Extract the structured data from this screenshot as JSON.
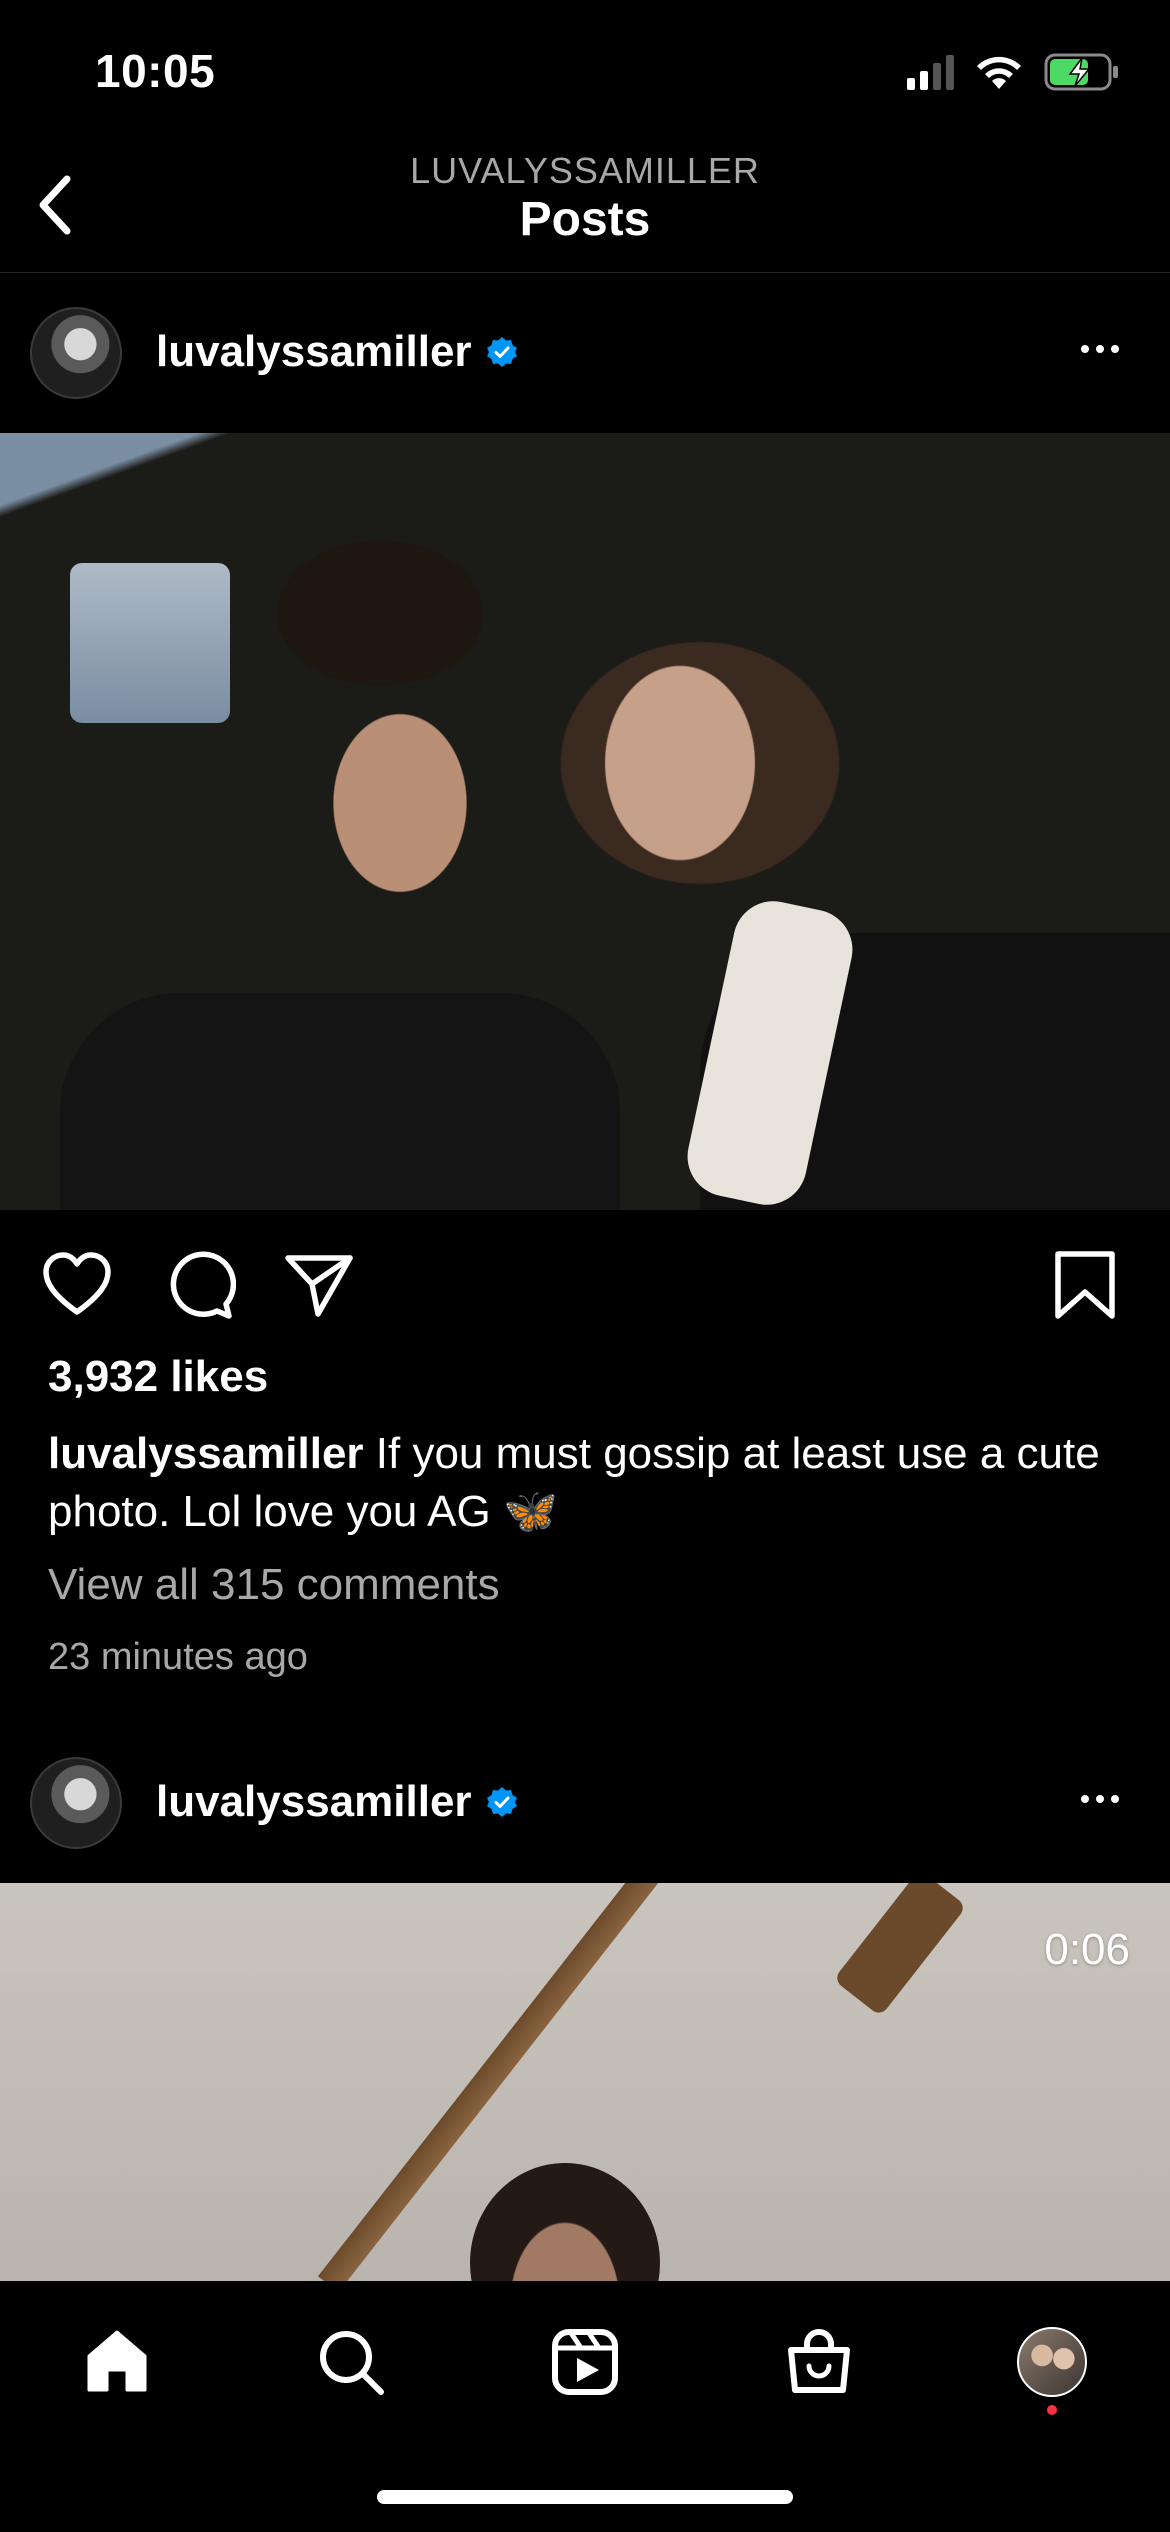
{
  "status_bar": {
    "time": "10:05",
    "icons": [
      "cellular-signal-icon",
      "wifi-icon",
      "battery-charging-icon"
    ]
  },
  "header": {
    "account": "LUVALYSSAMILLER",
    "title": "Posts",
    "back_icon": "chevron-left-icon"
  },
  "posts": [
    {
      "username": "luvalyssamiller",
      "verified": true,
      "likes": "3,932 likes",
      "caption_user": "luvalyssamiller",
      "caption_text": "If you must gossip at least use a cute photo. Lol love you AG 🦋",
      "comments_link": "View all 315 comments",
      "timestamp": "23 minutes ago"
    },
    {
      "username": "luvalyssamiller",
      "verified": true,
      "video_duration": "0:06"
    }
  ],
  "actions": {
    "like_icon": "heart-icon",
    "comment_icon": "comment-icon",
    "share_icon": "send-icon",
    "save_icon": "bookmark-icon"
  },
  "tab_bar": {
    "tabs": [
      "home-icon",
      "search-icon",
      "reels-icon",
      "shop-icon",
      "profile-avatar"
    ],
    "active": "home"
  },
  "colors": {
    "background": "#000000",
    "text_primary": "#ffffff",
    "text_secondary": "#a8a8a8",
    "verified_blue": "#0095f6",
    "notification_red": "#ff3040",
    "battery_green": "#4cd964"
  }
}
